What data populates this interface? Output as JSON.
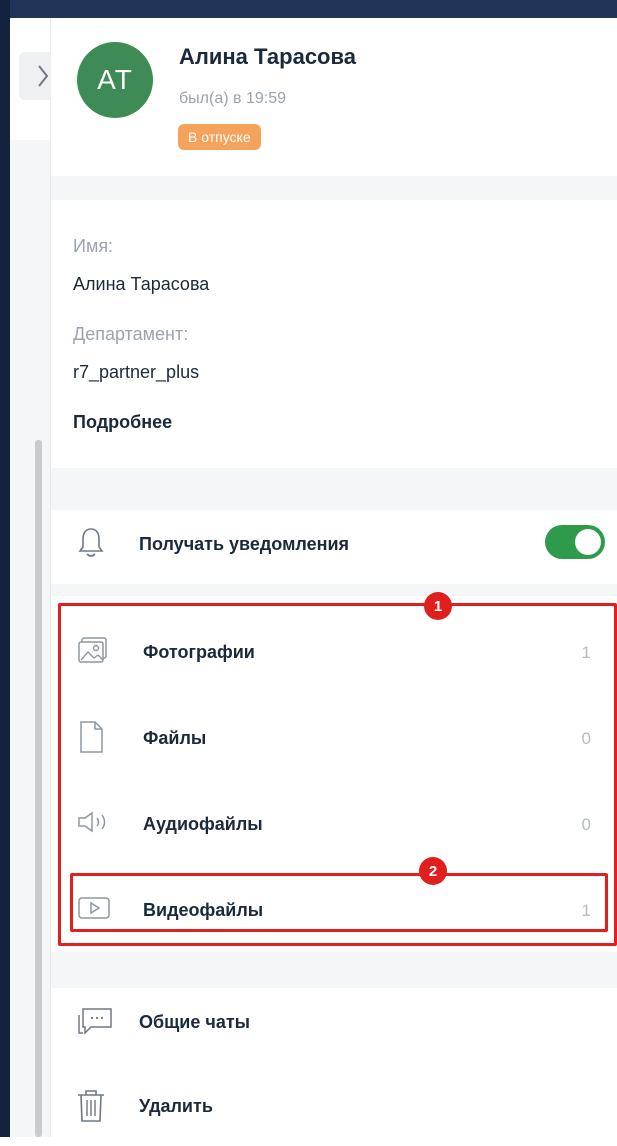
{
  "profile": {
    "initials": "AT",
    "name": "Алина Тарасова",
    "last_seen": "был(а) в 19:59",
    "status_badge": "В отпуске",
    "avatar_color": "#3e8b56",
    "badge_color": "#f5a25c"
  },
  "info": {
    "name_label": "Имя:",
    "name_value": "Алина Тарасова",
    "department_label": "Департамент:",
    "department_value": "r7_partner_plus",
    "more_link": "Подробнее"
  },
  "notifications": {
    "label": "Получать уведомления",
    "enabled": true,
    "toggle_color": "#2e9b4c",
    "icon": "bell-icon"
  },
  "media": [
    {
      "label": "Фотографии",
      "count": "1",
      "icon": "photo-icon"
    },
    {
      "label": "Файлы",
      "count": "0",
      "icon": "file-icon"
    },
    {
      "label": "Аудиофайлы",
      "count": "0",
      "icon": "audio-icon"
    },
    {
      "label": "Видеофайлы",
      "count": "1",
      "icon": "video-icon"
    }
  ],
  "actions": [
    {
      "label": "Общие чаты",
      "icon": "chat-icon"
    },
    {
      "label": "Удалить",
      "icon": "trash-icon"
    }
  ],
  "annotations": {
    "marker_1": "1",
    "marker_2": "2",
    "color": "#e21f1f"
  }
}
